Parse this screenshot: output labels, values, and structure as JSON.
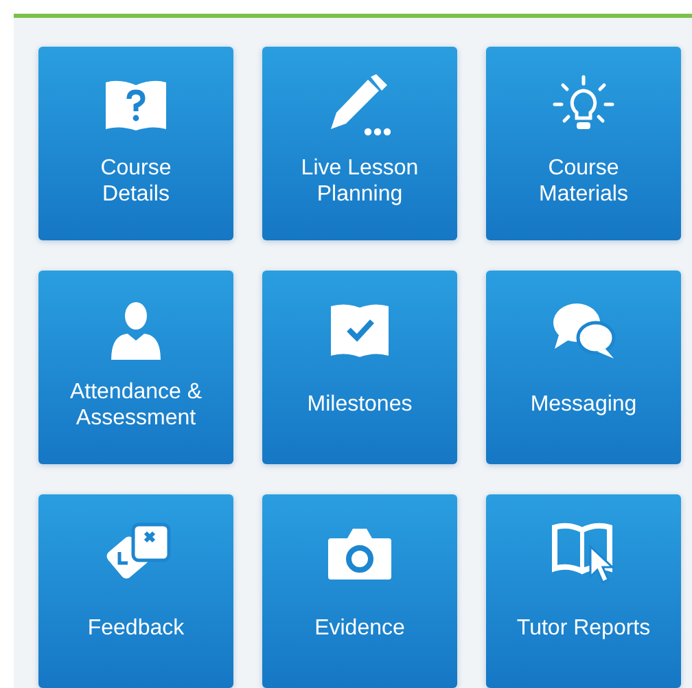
{
  "tiles": [
    {
      "label": "Course\nDetails",
      "kind": "book-question"
    },
    {
      "label": "Live Lesson\nPlanning",
      "kind": "pencil"
    },
    {
      "label": "Course\nMaterials",
      "kind": "lightbulb"
    },
    {
      "label": "Attendance &\nAssessment",
      "kind": "person"
    },
    {
      "label": "Milestones",
      "kind": "checkbox"
    },
    {
      "label": "Messaging",
      "kind": "chat"
    },
    {
      "label": "Feedback",
      "kind": "cards"
    },
    {
      "label": "Evidence",
      "kind": "camera"
    },
    {
      "label": "Tutor Reports",
      "kind": "book-cursor"
    }
  ]
}
